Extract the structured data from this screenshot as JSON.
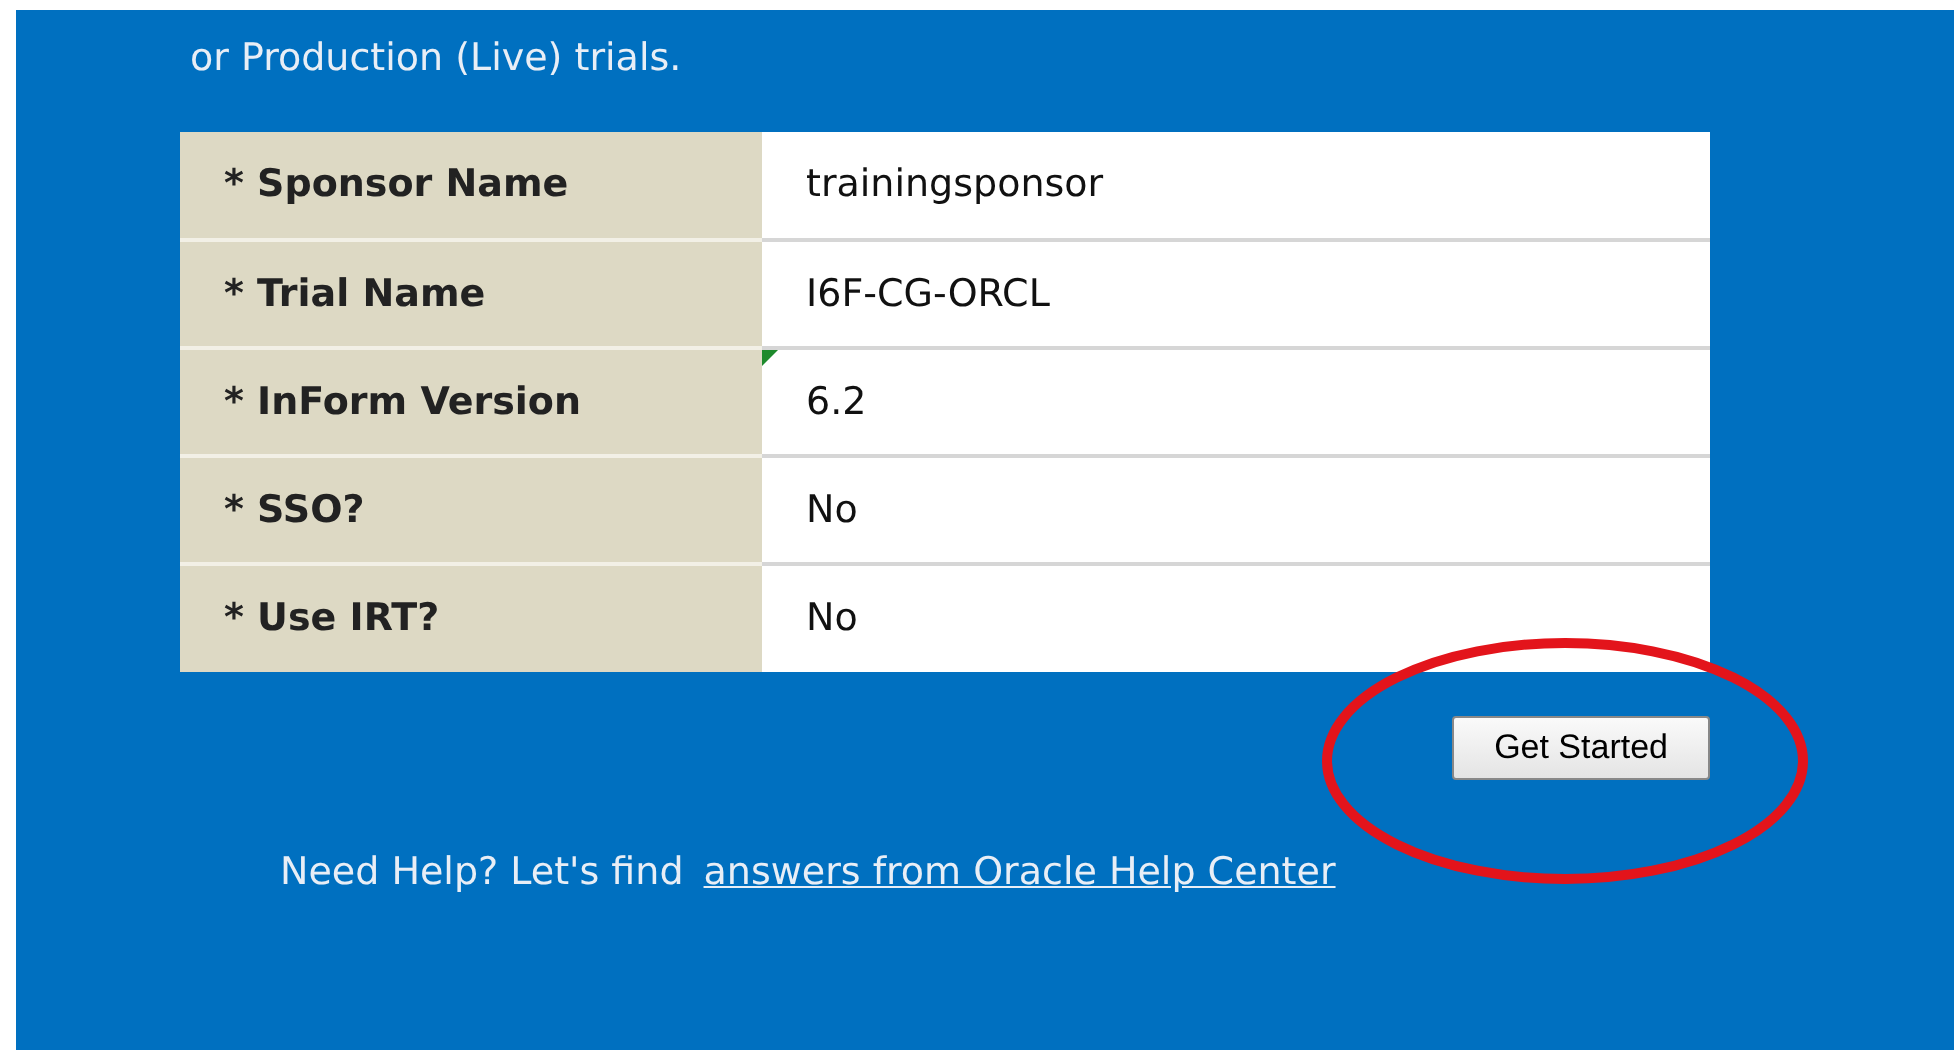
{
  "intro": "or Production (Live) trials.",
  "fields": [
    {
      "label": "* Sponsor Name",
      "value": "trainingsponsor",
      "note_marker": false
    },
    {
      "label": "* Trial Name",
      "value": "I6F-CG-ORCL",
      "note_marker": false
    },
    {
      "label": "* InForm Version",
      "value": "6.2",
      "note_marker": true
    },
    {
      "label": "* SSO?",
      "value": "No",
      "note_marker": false
    },
    {
      "label": "* Use IRT?",
      "value": "No",
      "note_marker": false
    }
  ],
  "button": {
    "label": "Get Started",
    "circled": true
  },
  "help": {
    "text": "Need Help? Let's find",
    "link": "answers from Oracle Help Center"
  }
}
